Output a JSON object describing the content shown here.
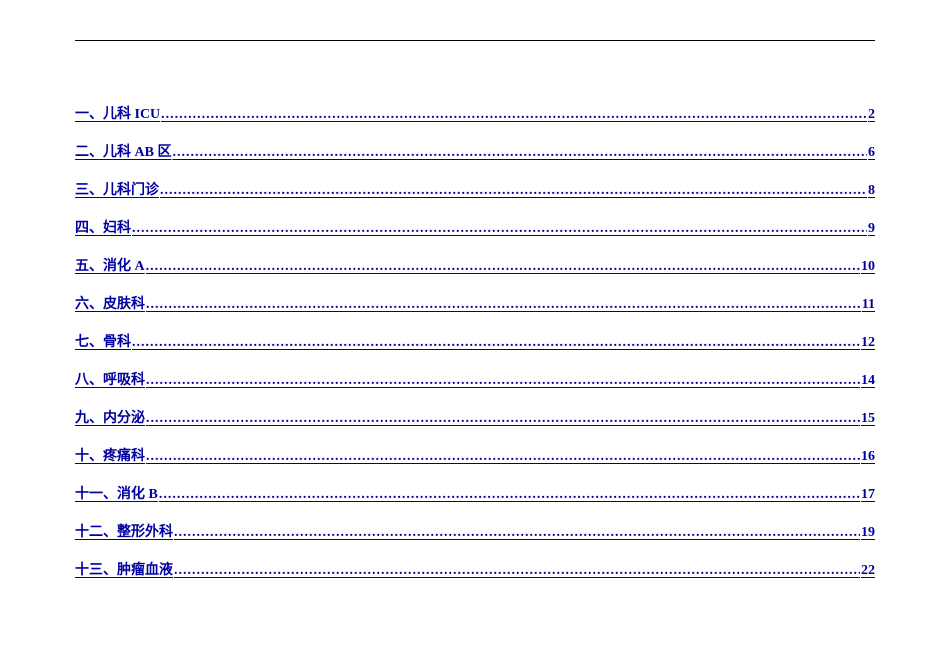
{
  "toc": {
    "entries": [
      {
        "label": "一、儿科 ICU",
        "page": "2"
      },
      {
        "label": "二、儿科 AB 区",
        "page": "6"
      },
      {
        "label": "三、儿科门诊",
        "page": "8"
      },
      {
        "label": "四、妇科",
        "page": "9"
      },
      {
        "label": "五、消化 A",
        "page": "10"
      },
      {
        "label": "六、皮肤科",
        "page": "11"
      },
      {
        "label": "七、骨科",
        "page": "12"
      },
      {
        "label": "八、呼吸科",
        "page": "14"
      },
      {
        "label": "九、内分泌",
        "page": "15"
      },
      {
        "label": "十、疼痛科",
        "page": "16"
      },
      {
        "label": "十一、消化 B",
        "page": "17"
      },
      {
        "label": "十二、整形外科",
        "page": "19"
      },
      {
        "label": "十三、肿瘤血液",
        "page": "22"
      }
    ]
  }
}
